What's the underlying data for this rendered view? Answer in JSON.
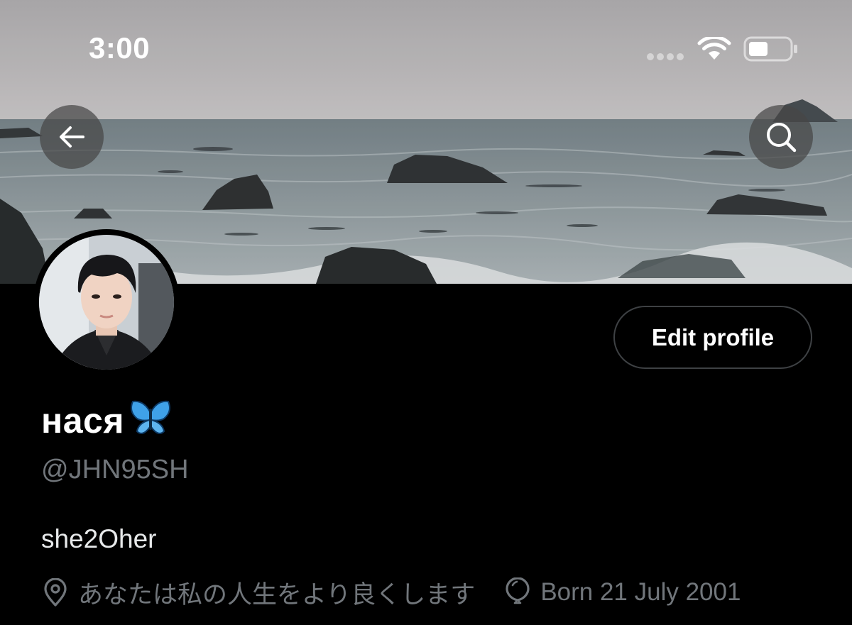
{
  "status_bar": {
    "time": "3:00"
  },
  "header": {
    "back_icon": "arrow-left-icon",
    "search_icon": "search-icon"
  },
  "profile": {
    "display_name": "нася",
    "name_emoji": "🦋",
    "handle": "@JHN95SH",
    "bio": "she2Oher",
    "location": "あなたは私の人生をより良くします",
    "birthday": "Born 21 July 2001",
    "edit_button_label": "Edit profile"
  },
  "colors": {
    "background": "#000000",
    "primary_text": "#e7e9ea",
    "secondary_text": "#71767b",
    "button_border": "#3e4144"
  }
}
